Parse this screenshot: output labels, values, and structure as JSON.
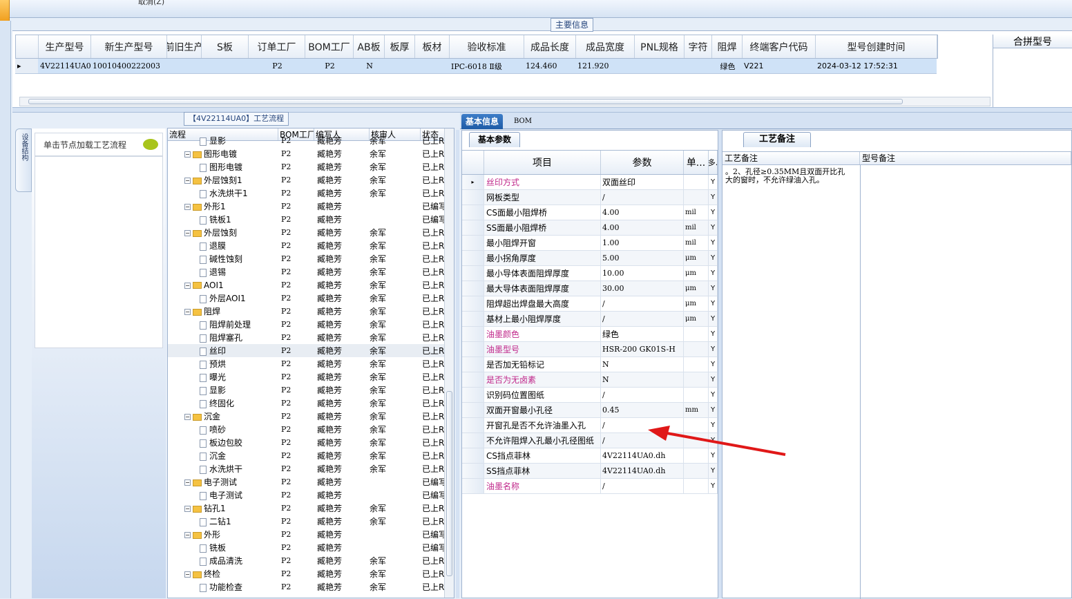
{
  "toolbar": {
    "cancel_label": "取消(Z)"
  },
  "main_info": {
    "legend": "主要信息",
    "columns": [
      "生产型号",
      "新生产型号",
      "升级前旧生产型号",
      "S板",
      "订单工厂",
      "BOM工厂",
      "AB板",
      "板厚",
      "板材",
      "验收标准",
      "成品长度",
      "成品宽度",
      "PNL规格",
      "字符",
      "阻焊",
      "终端客户代码",
      "型号创建时间"
    ],
    "row": {
      "生产型号": "4V22114UA0",
      "新生产型号": "10010400222003",
      "升级前旧生产型号": "",
      "S板": "",
      "订单工厂": "P2",
      "BOM工厂": "P2",
      "AB板": "N",
      "板厚": "",
      "板材": "",
      "验收标准": "IPC-6018 Ⅱ级",
      "成品长度": "124.460",
      "成品宽度": "121.920",
      "PNL规格": "",
      "字符": "",
      "阻焊": "绿色",
      "终端客户代码": "V221",
      "型号创建时间": "2024-03-12 17:52:31"
    },
    "merge_label": "合拼型号"
  },
  "flow": {
    "title": "【4V22114UA0】工艺流程",
    "side_tab": "设备结构",
    "hint": "单击节点加载工艺流程",
    "columns": [
      "流程",
      "BOM工厂",
      "编写人",
      "核审人",
      "状态"
    ],
    "rows": [
      {
        "name": "显影",
        "lvl": 1,
        "folder": false,
        "bom": "P2",
        "author": "臧艳芳",
        "reviewer": "余军",
        "status": "已上R"
      },
      {
        "name": "图形电镀",
        "lvl": 0,
        "folder": true,
        "bom": "P2",
        "author": "臧艳芳",
        "reviewer": "余军",
        "status": "已上R"
      },
      {
        "name": "图形电镀",
        "lvl": 1,
        "folder": false,
        "bom": "P2",
        "author": "臧艳芳",
        "reviewer": "余军",
        "status": "已上R"
      },
      {
        "name": "外层蚀刻1",
        "lvl": 0,
        "folder": true,
        "bom": "P2",
        "author": "臧艳芳",
        "reviewer": "余军",
        "status": "已上R"
      },
      {
        "name": "水洗烘干1",
        "lvl": 1,
        "folder": false,
        "bom": "P2",
        "author": "臧艳芳",
        "reviewer": "余军",
        "status": "已上R"
      },
      {
        "name": "外形1",
        "lvl": 0,
        "folder": true,
        "bom": "P2",
        "author": "臧艳芳",
        "reviewer": "",
        "status": "已编写"
      },
      {
        "name": "铣板1",
        "lvl": 1,
        "folder": false,
        "bom": "P2",
        "author": "臧艳芳",
        "reviewer": "",
        "status": "已编写"
      },
      {
        "name": "外层蚀刻",
        "lvl": 0,
        "folder": true,
        "bom": "P2",
        "author": "臧艳芳",
        "reviewer": "余军",
        "status": "已上R"
      },
      {
        "name": "退膜",
        "lvl": 1,
        "folder": false,
        "bom": "P2",
        "author": "臧艳芳",
        "reviewer": "余军",
        "status": "已上R"
      },
      {
        "name": "碱性蚀刻",
        "lvl": 1,
        "folder": false,
        "bom": "P2",
        "author": "臧艳芳",
        "reviewer": "余军",
        "status": "已上R"
      },
      {
        "name": "退锡",
        "lvl": 1,
        "folder": false,
        "bom": "P2",
        "author": "臧艳芳",
        "reviewer": "余军",
        "status": "已上R"
      },
      {
        "name": "AOI1",
        "lvl": 0,
        "folder": true,
        "bom": "P2",
        "author": "臧艳芳",
        "reviewer": "余军",
        "status": "已上R"
      },
      {
        "name": "外层AOI1",
        "lvl": 1,
        "folder": false,
        "bom": "P2",
        "author": "臧艳芳",
        "reviewer": "余军",
        "status": "已上R"
      },
      {
        "name": "阻焊",
        "lvl": 0,
        "folder": true,
        "bom": "P2",
        "author": "臧艳芳",
        "reviewer": "余军",
        "status": "已上R"
      },
      {
        "name": "阻焊前处理",
        "lvl": 1,
        "folder": false,
        "bom": "P2",
        "author": "臧艳芳",
        "reviewer": "余军",
        "status": "已上R"
      },
      {
        "name": "阻焊塞孔",
        "lvl": 1,
        "folder": false,
        "bom": "P2",
        "author": "臧艳芳",
        "reviewer": "余军",
        "status": "已上R"
      },
      {
        "name": "丝印",
        "lvl": 1,
        "folder": false,
        "bom": "P2",
        "author": "臧艳芳",
        "reviewer": "余军",
        "status": "已上R",
        "selected": true
      },
      {
        "name": "预烘",
        "lvl": 1,
        "folder": false,
        "bom": "P2",
        "author": "臧艳芳",
        "reviewer": "余军",
        "status": "已上R"
      },
      {
        "name": "曝光",
        "lvl": 1,
        "folder": false,
        "bom": "P2",
        "author": "臧艳芳",
        "reviewer": "余军",
        "status": "已上R"
      },
      {
        "name": "显影",
        "lvl": 1,
        "folder": false,
        "bom": "P2",
        "author": "臧艳芳",
        "reviewer": "余军",
        "status": "已上R"
      },
      {
        "name": "终固化",
        "lvl": 1,
        "folder": false,
        "bom": "P2",
        "author": "臧艳芳",
        "reviewer": "余军",
        "status": "已上R"
      },
      {
        "name": "沉金",
        "lvl": 0,
        "folder": true,
        "bom": "P2",
        "author": "臧艳芳",
        "reviewer": "余军",
        "status": "已上R"
      },
      {
        "name": "喷砂",
        "lvl": 1,
        "folder": false,
        "bom": "P2",
        "author": "臧艳芳",
        "reviewer": "余军",
        "status": "已上R"
      },
      {
        "name": "板边包胶",
        "lvl": 1,
        "folder": false,
        "bom": "P2",
        "author": "臧艳芳",
        "reviewer": "余军",
        "status": "已上R"
      },
      {
        "name": "沉金",
        "lvl": 1,
        "folder": false,
        "bom": "P2",
        "author": "臧艳芳",
        "reviewer": "余军",
        "status": "已上R"
      },
      {
        "name": "水洗烘干",
        "lvl": 1,
        "folder": false,
        "bom": "P2",
        "author": "臧艳芳",
        "reviewer": "余军",
        "status": "已上R"
      },
      {
        "name": "电子测试",
        "lvl": 0,
        "folder": true,
        "bom": "P2",
        "author": "臧艳芳",
        "reviewer": "",
        "status": "已编写"
      },
      {
        "name": "电子测试",
        "lvl": 1,
        "folder": false,
        "bom": "P2",
        "author": "臧艳芳",
        "reviewer": "",
        "status": "已编写"
      },
      {
        "name": "钻孔1",
        "lvl": 0,
        "folder": true,
        "bom": "P2",
        "author": "臧艳芳",
        "reviewer": "余军",
        "status": "已上R"
      },
      {
        "name": "二钻1",
        "lvl": 1,
        "folder": false,
        "bom": "P2",
        "author": "臧艳芳",
        "reviewer": "余军",
        "status": "已上R"
      },
      {
        "name": "外形",
        "lvl": 0,
        "folder": true,
        "bom": "P2",
        "author": "臧艳芳",
        "reviewer": "",
        "status": "已编写"
      },
      {
        "name": "铣板",
        "lvl": 1,
        "folder": false,
        "bom": "P2",
        "author": "臧艳芳",
        "reviewer": "",
        "status": "已编写"
      },
      {
        "name": "成品清洗",
        "lvl": 1,
        "folder": false,
        "bom": "P2",
        "author": "臧艳芳",
        "reviewer": "余军",
        "status": "已上R"
      },
      {
        "name": "终检",
        "lvl": 0,
        "folder": true,
        "bom": "P2",
        "author": "臧艳芳",
        "reviewer": "余军",
        "status": "已上R"
      },
      {
        "name": "功能检查",
        "lvl": 1,
        "folder": false,
        "bom": "P2",
        "author": "臧艳芳",
        "reviewer": "余军",
        "status": "已上R"
      }
    ]
  },
  "right": {
    "tabs": [
      "基本信息",
      "BOM"
    ],
    "params_tab": "基本参数",
    "param_cols": [
      "项目",
      "参数",
      "单...",
      "多."
    ],
    "params": [
      {
        "item": "丝印方式",
        "value": "双面丝印",
        "unit": "",
        "flag": "Y",
        "pink": true
      },
      {
        "item": "网板类型",
        "value": "/",
        "unit": "",
        "flag": "Y"
      },
      {
        "item": "CS面最小阻焊桥",
        "value": "4.00",
        "unit": "mil",
        "flag": "Y"
      },
      {
        "item": "SS面最小阻焊桥",
        "value": "4.00",
        "unit": "mil",
        "flag": "Y"
      },
      {
        "item": "最小阻焊开窗",
        "value": "1.00",
        "unit": "mil",
        "flag": "Y"
      },
      {
        "item": "最小拐角厚度",
        "value": "5.00",
        "unit": "μm",
        "flag": "Y"
      },
      {
        "item": "最小导体表面阻焊厚度",
        "value": "10.00",
        "unit": "μm",
        "flag": "Y"
      },
      {
        "item": "最大导体表面阻焊厚度",
        "value": "30.00",
        "unit": "μm",
        "flag": "Y"
      },
      {
        "item": "阻焊超出焊盘最大高度",
        "value": "/",
        "unit": "μm",
        "flag": "Y"
      },
      {
        "item": "基材上最小阻焊厚度",
        "value": "/",
        "unit": "μm",
        "flag": "Y"
      },
      {
        "item": "油墨颜色",
        "value": "绿色",
        "unit": "",
        "flag": "Y",
        "pink": true
      },
      {
        "item": "油墨型号",
        "value": "HSR-200 GK01S-H",
        "unit": "",
        "flag": "Y",
        "pink": true
      },
      {
        "item": "是否加无铅标记",
        "value": "N",
        "unit": "",
        "flag": "Y"
      },
      {
        "item": "是否为无卤素",
        "value": "N",
        "unit": "",
        "flag": "Y",
        "pink": true
      },
      {
        "item": "识别码位置图纸",
        "value": "/",
        "unit": "",
        "flag": "Y"
      },
      {
        "item": "双面开窗最小孔径",
        "value": "0.45",
        "unit": "mm",
        "flag": "Y"
      },
      {
        "item": "开窗孔是否不允许油墨入孔",
        "value": "/",
        "unit": "",
        "flag": "Y"
      },
      {
        "item": "不允许阻焊入孔最小孔径图纸",
        "value": "/",
        "unit": "",
        "flag": "Y"
      },
      {
        "item": "CS挡点菲林",
        "value": "4V22114UA0.dh",
        "unit": "",
        "flag": "Y"
      },
      {
        "item": "SS挡点菲林",
        "value": "4V22114UA0.dh",
        "unit": "",
        "flag": "Y"
      },
      {
        "item": "油墨名称",
        "value": "/",
        "unit": "",
        "flag": "Y",
        "pink": true
      }
    ],
    "notes_tab": "工艺备注",
    "notes_cols": [
      "工艺备注",
      "型号备注"
    ],
    "notes_text": "。2、孔径≥0.35MM且双面开比孔大的窗时，不允许绿油入孔。"
  },
  "colors": {
    "accent": "#1e5ba6",
    "selected_row": "#cfe2f7",
    "pink_text": "#c0288a",
    "arrow": "#e01818"
  }
}
